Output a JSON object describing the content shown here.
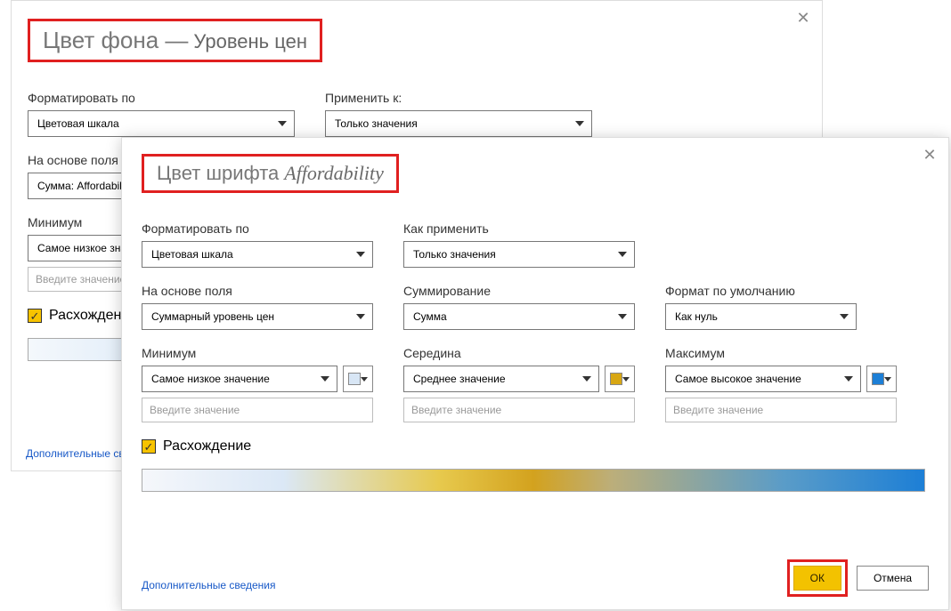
{
  "backDialog": {
    "titleMain": "Цвет фона —",
    "titleSub": "Уровень цен",
    "formatByLabel": "Форматировать по",
    "formatBy": "Цветовая шкала",
    "applyToLabel": "Применить к:",
    "applyTo": "Только значения",
    "basedOnLabel": "На основе поля",
    "basedOn": "Сумма: Affordability",
    "minLabel": "Минимум",
    "minSel": "Самое низкое значение",
    "valuePlaceholder": "Введите значение",
    "divergingLabel": "Расхождение",
    "moreInfo": "Дополнительные сведения"
  },
  "frontDialog": {
    "titleMain": "Цвет шрифта",
    "titleSub": "Affordability",
    "formatByLabel": "Форматировать по",
    "formatBy": "Цветовая шкала",
    "applyLabel": "Как применить",
    "applyTo": "Только значения",
    "basedOnLabel": "На основе поля",
    "basedOn": "Суммарный уровень цен",
    "summarizationLabel": "Суммирование",
    "summarization": "Сумма",
    "defaultFmtLabel": "Формат по умолчанию",
    "defaultFmt": "Как нуль",
    "minLabel": "Минимум",
    "minSel": "Самое низкое значение",
    "midLabel": "Середина",
    "midSel": "Среднее значение",
    "maxLabel": "Максимум",
    "maxSel": "Самое высокое значение",
    "valuePlaceholder": "Введите значение",
    "colorMin": "#d8e6f5",
    "colorMid": "#d8a714",
    "colorMax": "#1d7fd6",
    "divergingLabel": "Расхождение",
    "moreInfo": "Дополнительные сведения",
    "okLabel": "ОК",
    "cancelLabel": "Отмена"
  }
}
